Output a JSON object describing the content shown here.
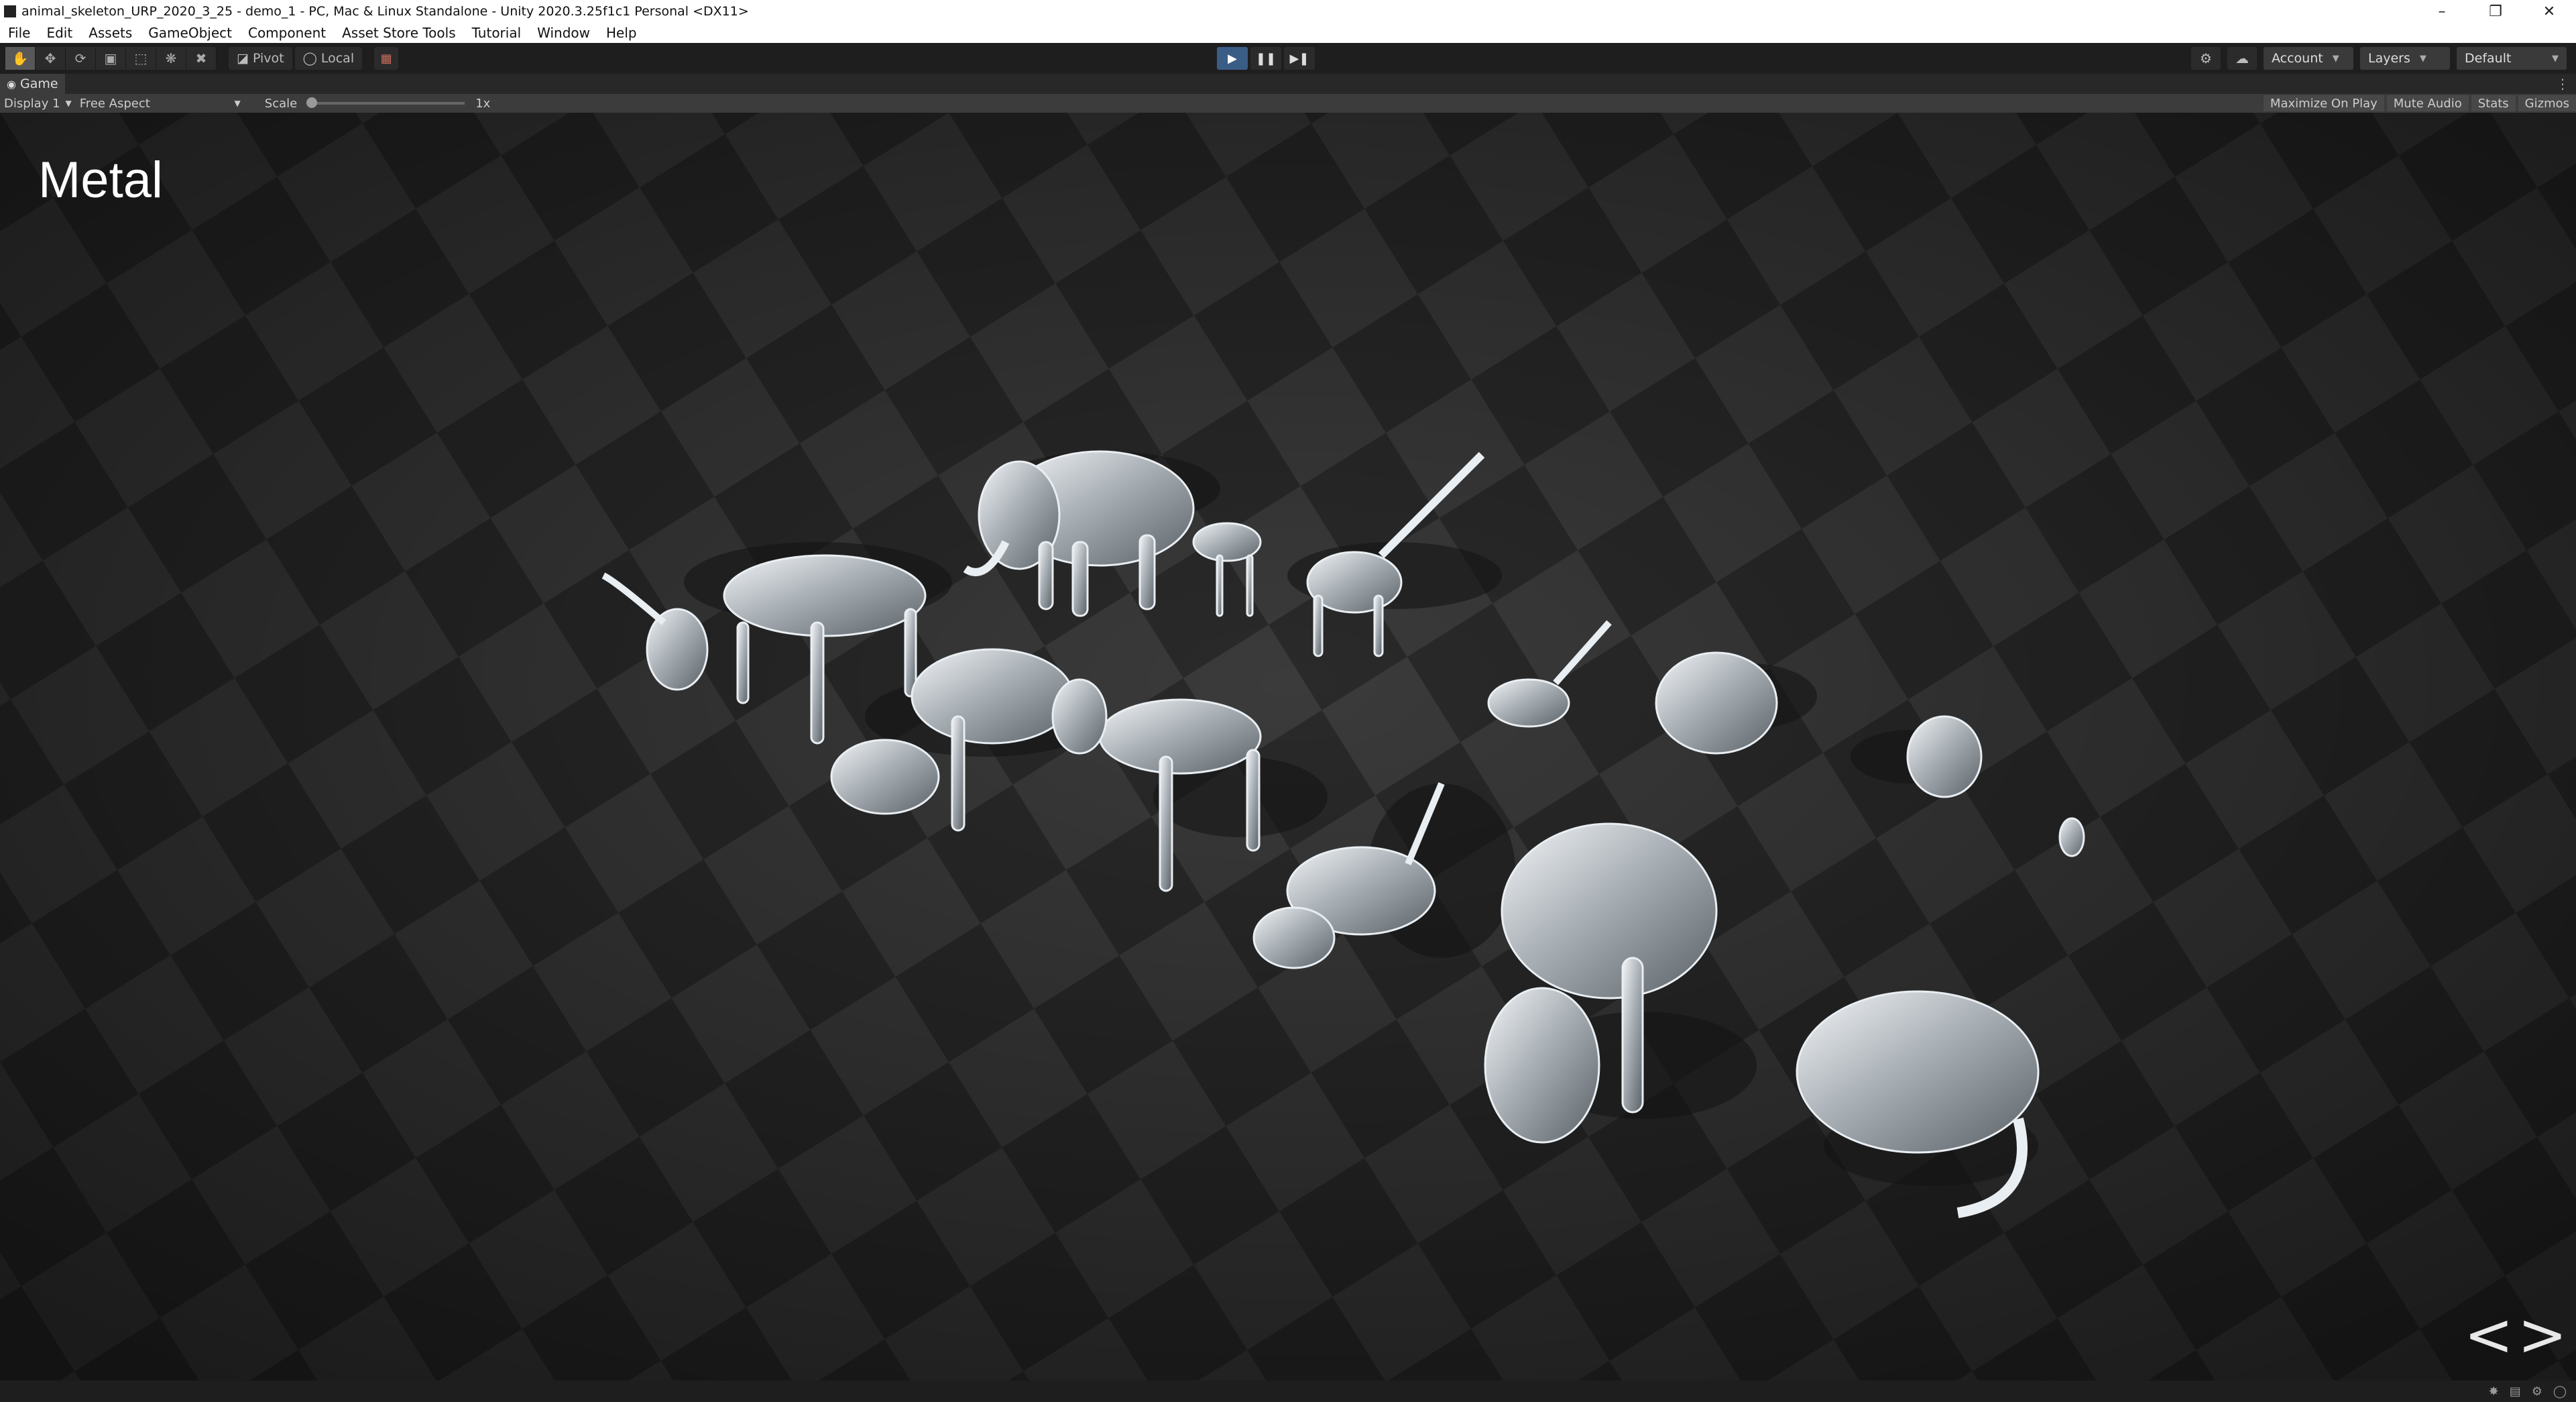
{
  "window": {
    "title": "animal_skeleton_URP_2020_3_25 - demo_1 - PC, Mac & Linux Standalone - Unity 2020.3.25f1c1 Personal <DX11>",
    "controls": [
      "minimize-icon",
      "restore-icon",
      "close-icon"
    ]
  },
  "menu": [
    "File",
    "Edit",
    "Assets",
    "GameObject",
    "Component",
    "Asset Store Tools",
    "Tutorial",
    "Window",
    "Help"
  ],
  "toolbar": {
    "tools": [
      "hand-tool-icon",
      "move-tool-icon",
      "rotate-tool-icon",
      "scale-tool-icon",
      "rect-tool-icon",
      "transform-tool-icon",
      "custom-tool-icon"
    ],
    "pivot_label": "Pivot",
    "local_label": "Local",
    "playback": [
      "play-icon",
      "pause-icon",
      "step-icon"
    ],
    "account_label": "Account",
    "layers_label": "Layers",
    "layout_label": "Default"
  },
  "game_view": {
    "tab_label": "Game",
    "display_label": "Display 1",
    "aspect_label": "Free Aspect",
    "scale_label": "Scale",
    "scale_value": "1x",
    "maximize_label": "Maximize On Play",
    "mute_label": "Mute Audio",
    "stats_label": "Stats",
    "gizmos_label": "Gizmos"
  },
  "scene": {
    "mode_title": "Metal",
    "prev_arrow": "<",
    "next_arrow": ">"
  }
}
